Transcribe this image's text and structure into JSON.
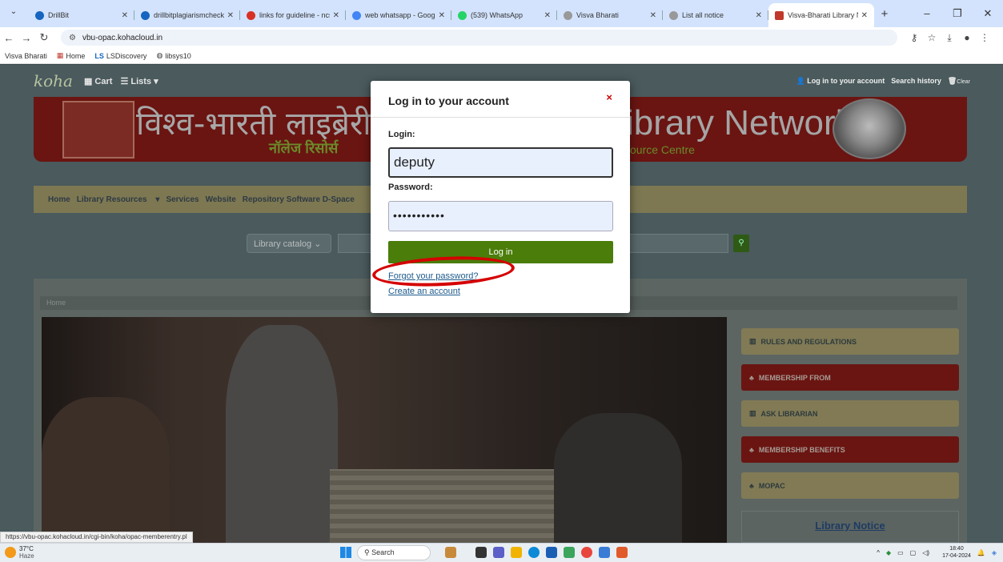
{
  "browser": {
    "tabs": [
      {
        "title": "DrillBit",
        "color": "#1565c0"
      },
      {
        "title": "drillbitplagiarismcheck.co",
        "color": "#1565c0"
      },
      {
        "title": "links for guideline - ncsal",
        "color": "#d93025"
      },
      {
        "title": "web whatsapp - Google S",
        "color": "#4285f4"
      },
      {
        "title": "(539) WhatsApp",
        "color": "#25d366"
      },
      {
        "title": "Visva Bharati",
        "color": "#999999"
      },
      {
        "title": "List all notice",
        "color": "#999999"
      },
      {
        "title": "Visva-Bharati Library Net",
        "color": "#c0392b"
      }
    ],
    "url": "vbu-opac.kohacloud.in",
    "bookmarks": [
      "Visva Bharati",
      "Home",
      "LSDiscovery",
      "libsys10"
    ],
    "status_url": "https://vbu-opac.kohacloud.in/cgi-bin/koha/opac-memberentry.pl"
  },
  "page": {
    "koha_logo": "koha",
    "cart": "Cart",
    "lists": "Lists",
    "login_link": "Log in to your account",
    "search_history": "Search history",
    "clear": "Clear",
    "banner_hindi_1": "विश्व-भारती लाइब्रेरी ने",
    "banner_hindi_2": "नॉलेज रिसोर्स",
    "banner_english": "ibrary Network",
    "banner_english_2": "ource Centre",
    "nav": [
      "Home",
      "Library Resources",
      "Services",
      "Website",
      "Repository Software D-Space"
    ],
    "search_select": "Library catalog",
    "breadcrumb": "Home",
    "side_buttons": [
      {
        "label": "RULES AND REGULATIONS",
        "style": "gold",
        "icon": "bank-icon"
      },
      {
        "label": "MEMBERSHIP FROM",
        "style": "red",
        "icon": "users-icon"
      },
      {
        "label": "ASK LIBRARIAN",
        "style": "gold",
        "icon": "bank-icon"
      },
      {
        "label": "MEMBERSHIP BENEFITS",
        "style": "red",
        "icon": "users-icon"
      },
      {
        "label": "MOPAC",
        "style": "gold",
        "icon": "users-icon"
      }
    ],
    "notice_title": "Library Notice"
  },
  "modal": {
    "title": "Log in to your account",
    "login_label": "Login:",
    "login_value": "deputy",
    "password_label": "Password:",
    "password_value": "•••••••••••",
    "login_button": "Log in",
    "forgot_link": "Forgot your password?",
    "create_link": "Create an account",
    "close": "×"
  },
  "taskbar": {
    "temperature": "37°C",
    "weather": "Haze",
    "search": "Search",
    "time": "18:40",
    "date": "17-04-2024"
  }
}
